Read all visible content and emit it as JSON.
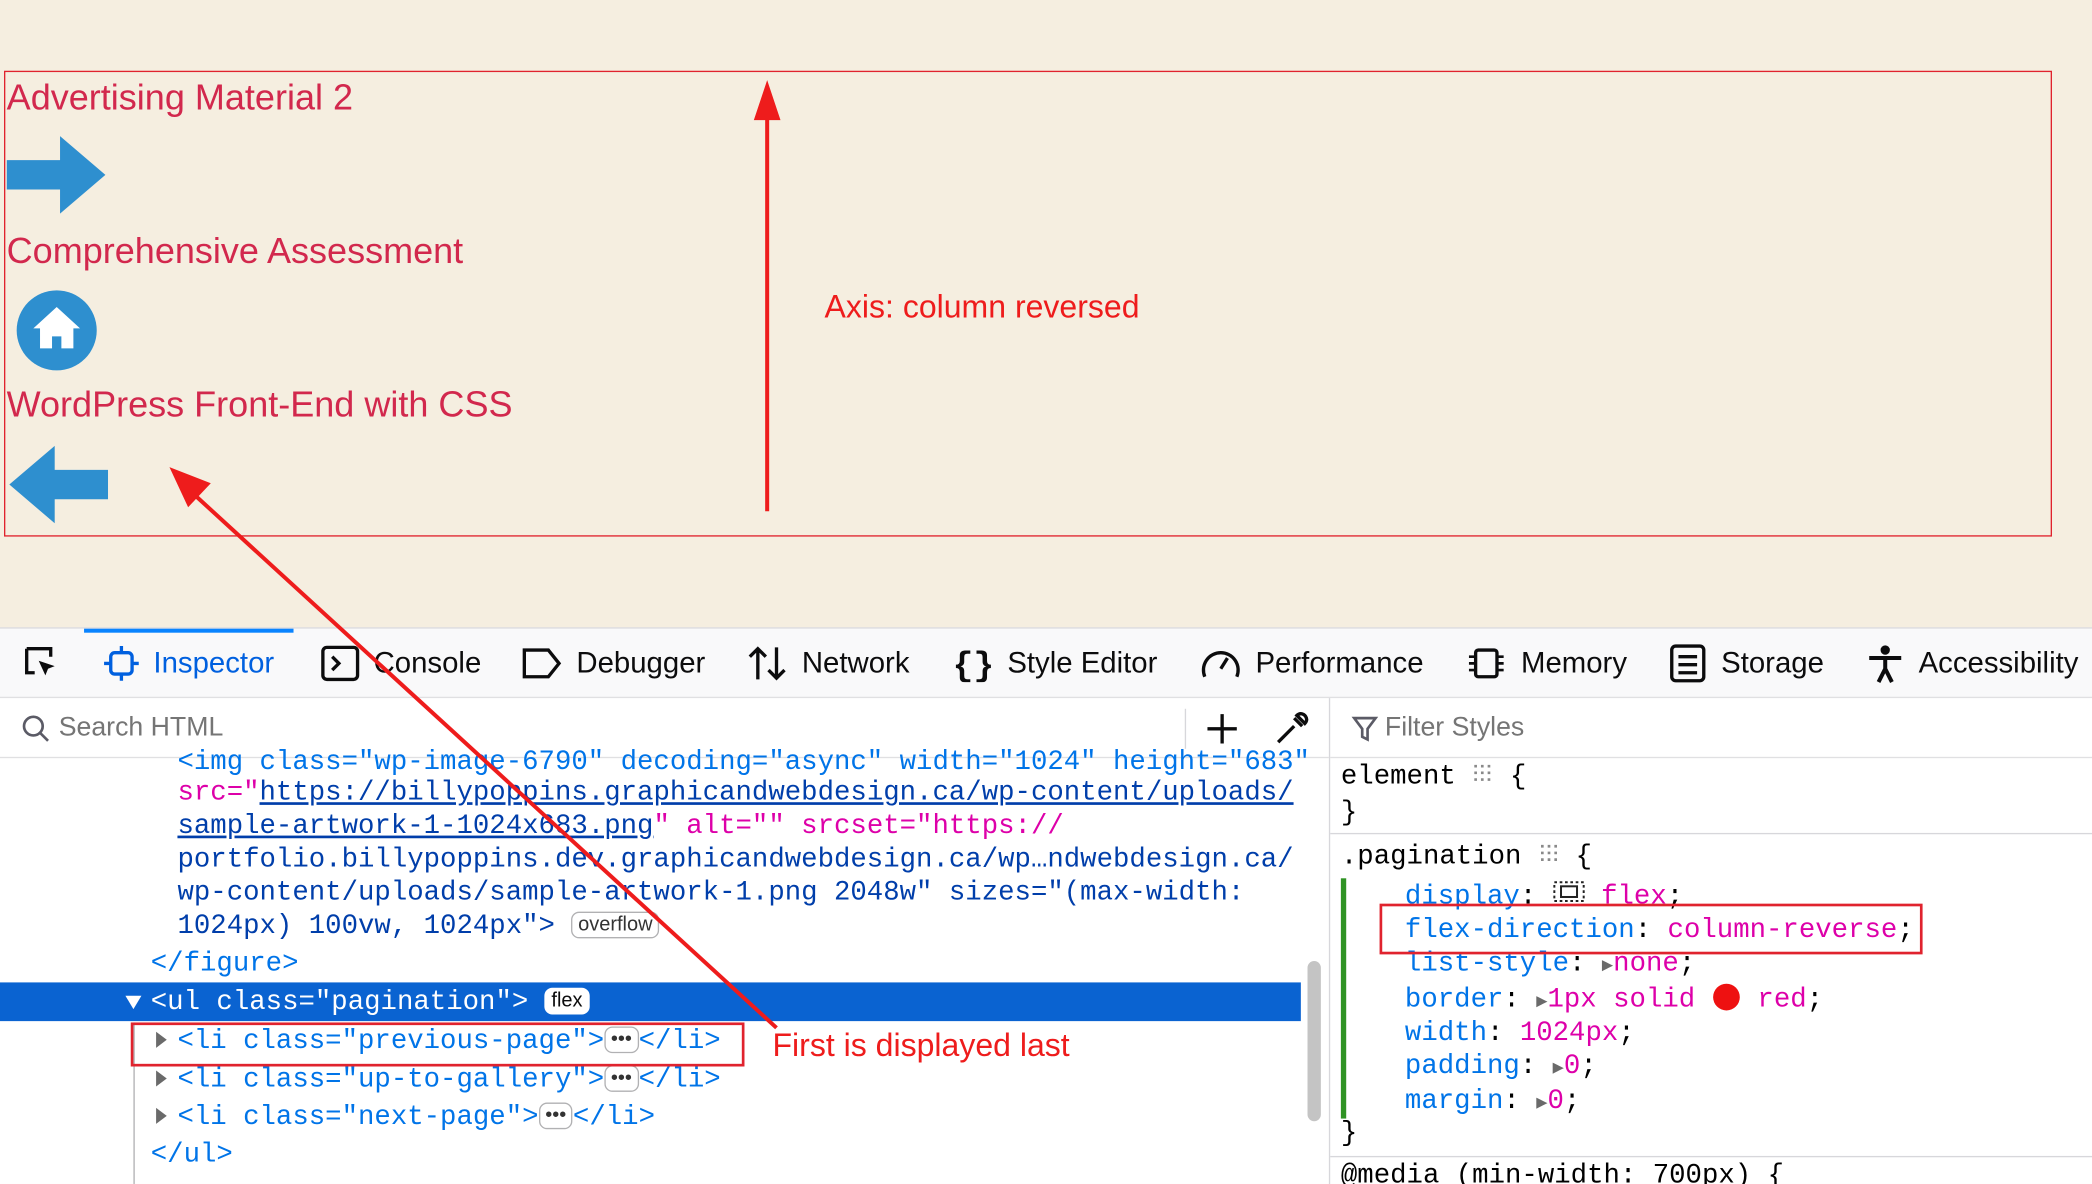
{
  "page": {
    "items": [
      {
        "label": "Advertising Material 2",
        "icon": "arrow-right-icon"
      },
      {
        "label": "Comprehensive Assessment",
        "icon": "home-icon"
      },
      {
        "label": "WordPress Front-End with CSS",
        "icon": "arrow-left-icon"
      }
    ]
  },
  "annotations": {
    "axis": "Axis: column reversed",
    "first": "First is displayed last"
  },
  "colors": {
    "accent": "#0a84ff",
    "annotation": "#ee1c1c",
    "link_text": "#d2284d",
    "icon_blue": "#2e8fcf"
  },
  "devtools": {
    "tabs": [
      "Inspector",
      "Console",
      "Debugger",
      "Network",
      "Style Editor",
      "Performance",
      "Memory",
      "Storage",
      "Accessibility"
    ],
    "active_tab": "Inspector",
    "search_html_placeholder": "Search HTML",
    "filter_styles_placeholder": "Filter Styles",
    "html_lines": {
      "l0": "<img class=\"wp-image-6790\" decoding=\"async\" width=\"1024\" height=\"683\"",
      "l1_a": "src=\"",
      "l1_b": "https://billypoppins.graphicandwebdesign.ca/wp-content/uploads/",
      "l2_a": "sample-artwork-1-1024x683.png",
      "l2_b": "\" alt=\"\" srcset=\"https://",
      "l3": "portfolio.billypoppins.dev.graphicandwebdesign.ca/wp…ndwebdesign.ca/",
      "l4": "wp-content/uploads/sample-artwork-1.png 2048w\" sizes=\"(max-width:",
      "l5": "1024px) 100vw, 1024px\">",
      "overflow_badge": "overflow",
      "fig_close": "</figure>",
      "ul_open": "<ul class=\"pagination\">",
      "flex_badge": "flex",
      "li1": "<li class=\"previous-page\">",
      "li2": "<li class=\"up-to-gallery\">",
      "li3": "<li class=\"next-page\">",
      "li_close": "</li>",
      "ul_close": "</ul>",
      "ellipsis": "•••"
    },
    "rules": {
      "element_selector": "element",
      "pagination_selector": ".pagination",
      "decls": [
        {
          "prop": "display",
          "value": "flex"
        },
        {
          "prop": "flex-direction",
          "value": "column-reverse"
        },
        {
          "prop": "list-style",
          "value": "none"
        },
        {
          "prop": "border",
          "value": "1px solid",
          "extra": "red"
        },
        {
          "prop": "width",
          "value": "1024px"
        },
        {
          "prop": "padding",
          "value": "0"
        },
        {
          "prop": "margin",
          "value": "0"
        }
      ],
      "media": "@media (min-width: 700px) {"
    }
  }
}
